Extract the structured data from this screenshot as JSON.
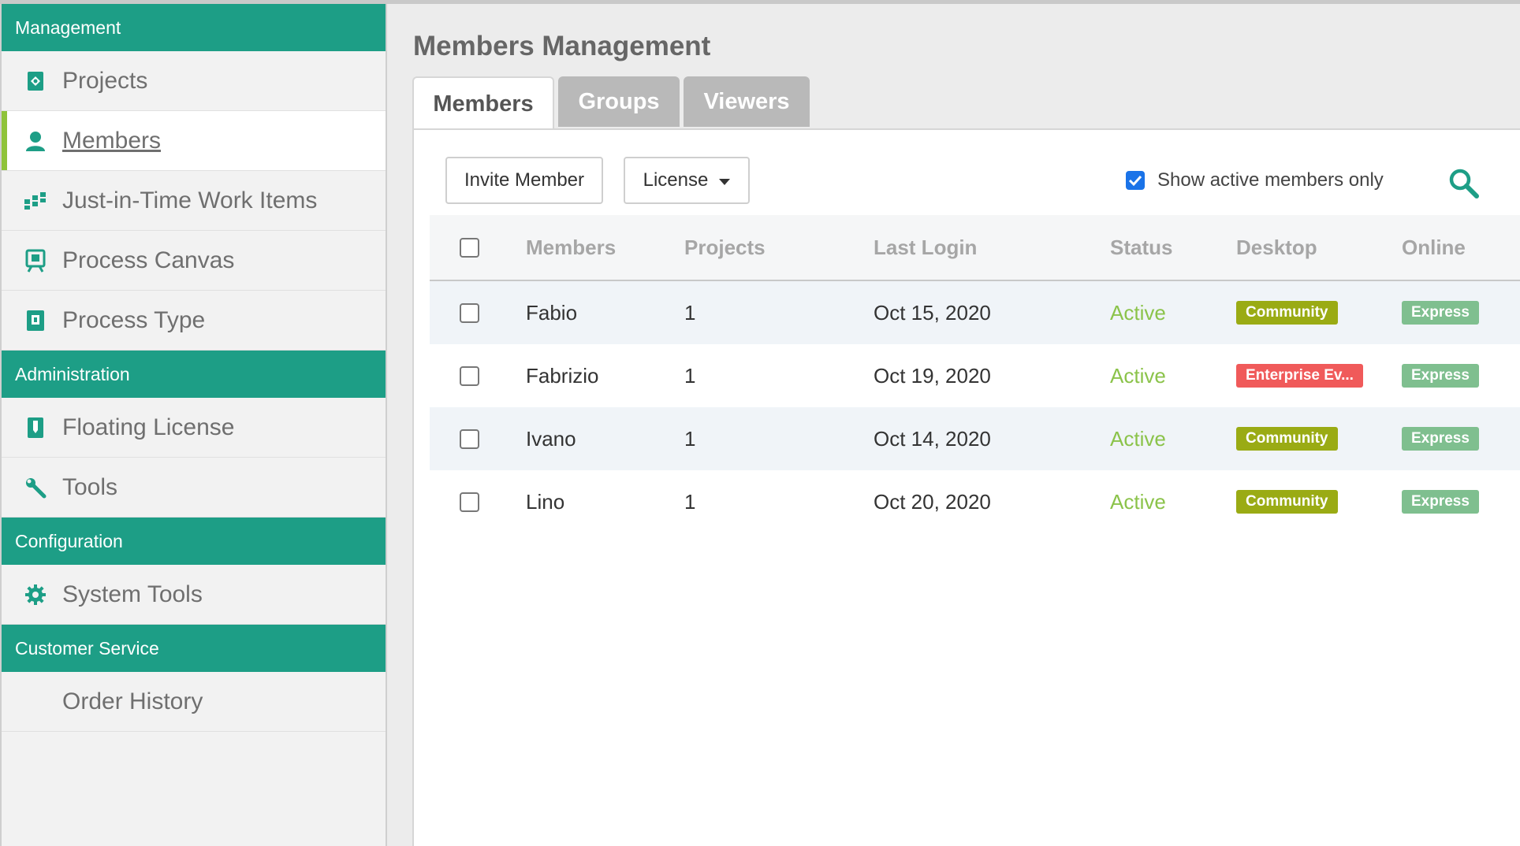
{
  "sidebar": {
    "sections": [
      {
        "header": "Management",
        "items": [
          {
            "label": "Projects",
            "icon": "projects-icon",
            "active": false
          },
          {
            "label": "Members",
            "icon": "person-icon",
            "active": true
          },
          {
            "label": "Just-in-Time Work Items",
            "icon": "work-items-icon",
            "active": false
          },
          {
            "label": "Process Canvas",
            "icon": "process-canvas-icon",
            "active": false
          },
          {
            "label": "Process Type",
            "icon": "process-type-icon",
            "active": false
          }
        ]
      },
      {
        "header": "Administration",
        "items": [
          {
            "label": "Floating License",
            "icon": "license-icon",
            "active": false
          },
          {
            "label": "Tools",
            "icon": "wrench-icon",
            "active": false
          }
        ]
      },
      {
        "header": "Configuration",
        "items": [
          {
            "label": "System Tools",
            "icon": "gear-icon",
            "active": false
          }
        ]
      },
      {
        "header": "Customer Service",
        "items": [
          {
            "label": "Order History",
            "icon": "",
            "active": false
          }
        ]
      }
    ]
  },
  "main": {
    "title": "Members Management",
    "tabs": [
      {
        "label": "Members",
        "active": true
      },
      {
        "label": "Groups",
        "active": false
      },
      {
        "label": "Viewers",
        "active": false
      }
    ],
    "toolbar": {
      "invite_label": "Invite Member",
      "license_label": "License",
      "active_only_label": "Show active members only",
      "active_only_checked": true
    },
    "table": {
      "columns": [
        "Members",
        "Projects",
        "Last Login",
        "Status",
        "Desktop",
        "Online"
      ],
      "rows": [
        {
          "member": "Fabio",
          "projects": "1",
          "last_login": "Oct 15, 2020",
          "status": "Active",
          "desktop": "Community",
          "online": "Express"
        },
        {
          "member": "Fabrizio",
          "projects": "1",
          "last_login": "Oct 19, 2020",
          "status": "Active",
          "desktop": "Enterprise Ev...",
          "online": "Express"
        },
        {
          "member": "Ivano",
          "projects": "1",
          "last_login": "Oct 14, 2020",
          "status": "Active",
          "desktop": "Community",
          "online": "Express"
        },
        {
          "member": "Lino",
          "projects": "1",
          "last_login": "Oct 20, 2020",
          "status": "Active",
          "desktop": "Community",
          "online": "Express"
        }
      ]
    }
  },
  "colors": {
    "accent": "#1d9e86",
    "active_marker": "#8fc33a",
    "status_active": "#8bc34a",
    "badge_community": "#9aab14",
    "badge_enterprise": "#f05a5a",
    "badge_express": "#7fbf8f"
  }
}
